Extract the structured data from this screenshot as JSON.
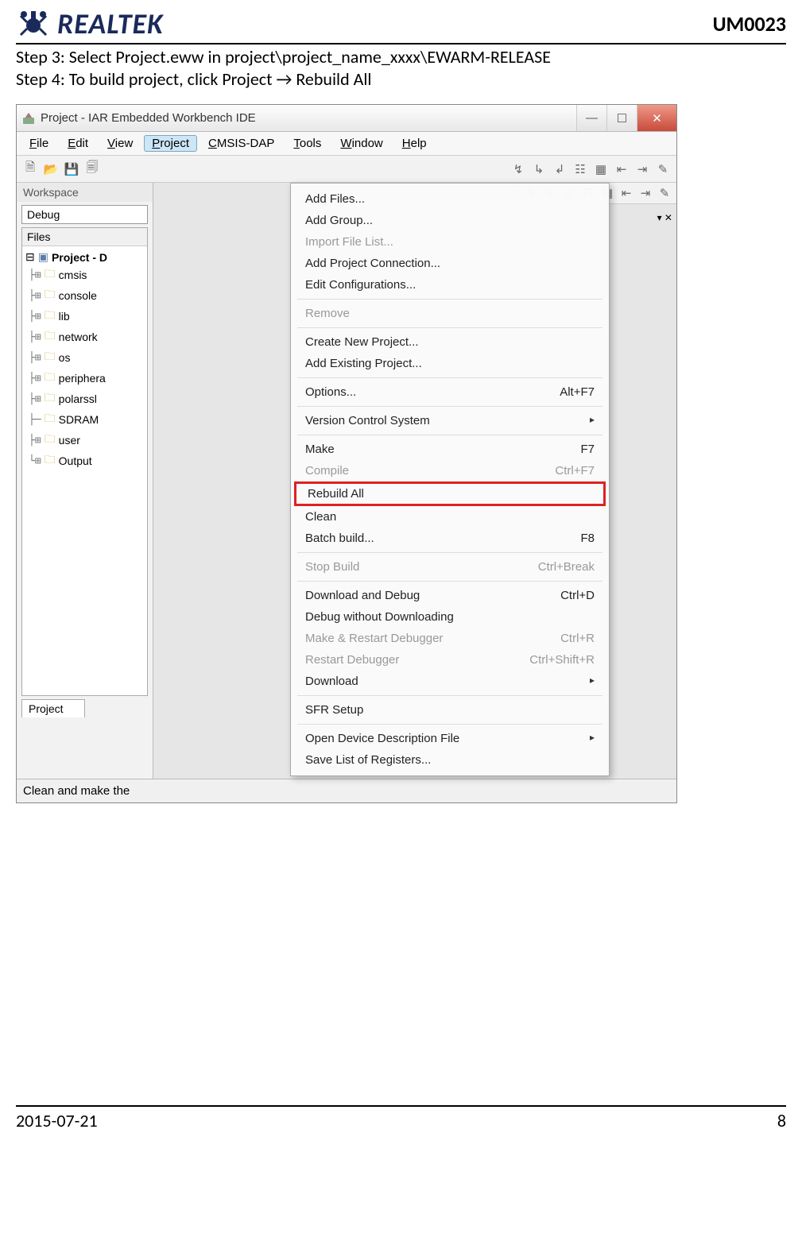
{
  "doc": {
    "brand": "REALTEK",
    "id": "UM0023",
    "step3": "Step 3: Select Project.eww in project\\project_name_xxxx\\EWARM-RELEASE",
    "step4": "Step 4: To build project, click Project → Rebuild All",
    "footer_date": "2015-07-21",
    "footer_page": "8"
  },
  "app": {
    "title": "Project - IAR Embedded Workbench IDE",
    "menus": [
      "File",
      "Edit",
      "View",
      "Project",
      "CMSIS-DAP",
      "Tools",
      "Window",
      "Help"
    ],
    "workspace_label": "Workspace",
    "config": "Debug",
    "files_header": "Files",
    "project_root": "Project - D",
    "tree": [
      {
        "name": "cmsis",
        "exp": true
      },
      {
        "name": "console",
        "exp": true
      },
      {
        "name": "lib",
        "exp": true
      },
      {
        "name": "network",
        "exp": true
      },
      {
        "name": "os",
        "exp": true
      },
      {
        "name": "periphera",
        "exp": true
      },
      {
        "name": "polarssl",
        "exp": true
      },
      {
        "name": "SDRAM",
        "exp": false
      },
      {
        "name": "user",
        "exp": true
      },
      {
        "name": "Output",
        "exp": true,
        "last": true
      }
    ],
    "project_tab": "Project",
    "status_text": "Clean and make the",
    "dropdown": [
      {
        "label": "Add Files...",
        "type": "item"
      },
      {
        "label": "Add Group...",
        "type": "item"
      },
      {
        "label": "Import File List...",
        "type": "disabled"
      },
      {
        "label": "Add Project Connection...",
        "type": "item"
      },
      {
        "label": "Edit Configurations...",
        "type": "item"
      },
      {
        "type": "sep"
      },
      {
        "label": "Remove",
        "type": "disabled"
      },
      {
        "type": "sep"
      },
      {
        "label": "Create New Project...",
        "type": "item"
      },
      {
        "label": "Add Existing Project...",
        "type": "item"
      },
      {
        "type": "sep"
      },
      {
        "label": "Options...",
        "shortcut": "Alt+F7",
        "type": "item"
      },
      {
        "type": "sep"
      },
      {
        "label": "Version Control System",
        "type": "submenu"
      },
      {
        "type": "sep"
      },
      {
        "label": "Make",
        "shortcut": "F7",
        "type": "item"
      },
      {
        "label": "Compile",
        "shortcut": "Ctrl+F7",
        "type": "disabled"
      },
      {
        "label": "Rebuild All",
        "type": "highlight"
      },
      {
        "label": "Clean",
        "type": "item"
      },
      {
        "label": "Batch build...",
        "shortcut": "F8",
        "type": "item"
      },
      {
        "type": "sep"
      },
      {
        "label": "Stop Build",
        "shortcut": "Ctrl+Break",
        "type": "disabled"
      },
      {
        "type": "sep"
      },
      {
        "label": "Download and Debug",
        "shortcut": "Ctrl+D",
        "type": "item"
      },
      {
        "label": "Debug without Downloading",
        "type": "item"
      },
      {
        "label": "Make & Restart Debugger",
        "shortcut": "Ctrl+R",
        "type": "disabled"
      },
      {
        "label": "Restart Debugger",
        "shortcut": "Ctrl+Shift+R",
        "type": "disabled"
      },
      {
        "label": "Download",
        "type": "submenu"
      },
      {
        "type": "sep"
      },
      {
        "label": "SFR Setup",
        "type": "item"
      },
      {
        "type": "sep"
      },
      {
        "label": "Open Device Description File",
        "type": "submenu"
      },
      {
        "label": "Save List of Registers...",
        "type": "item"
      }
    ]
  }
}
